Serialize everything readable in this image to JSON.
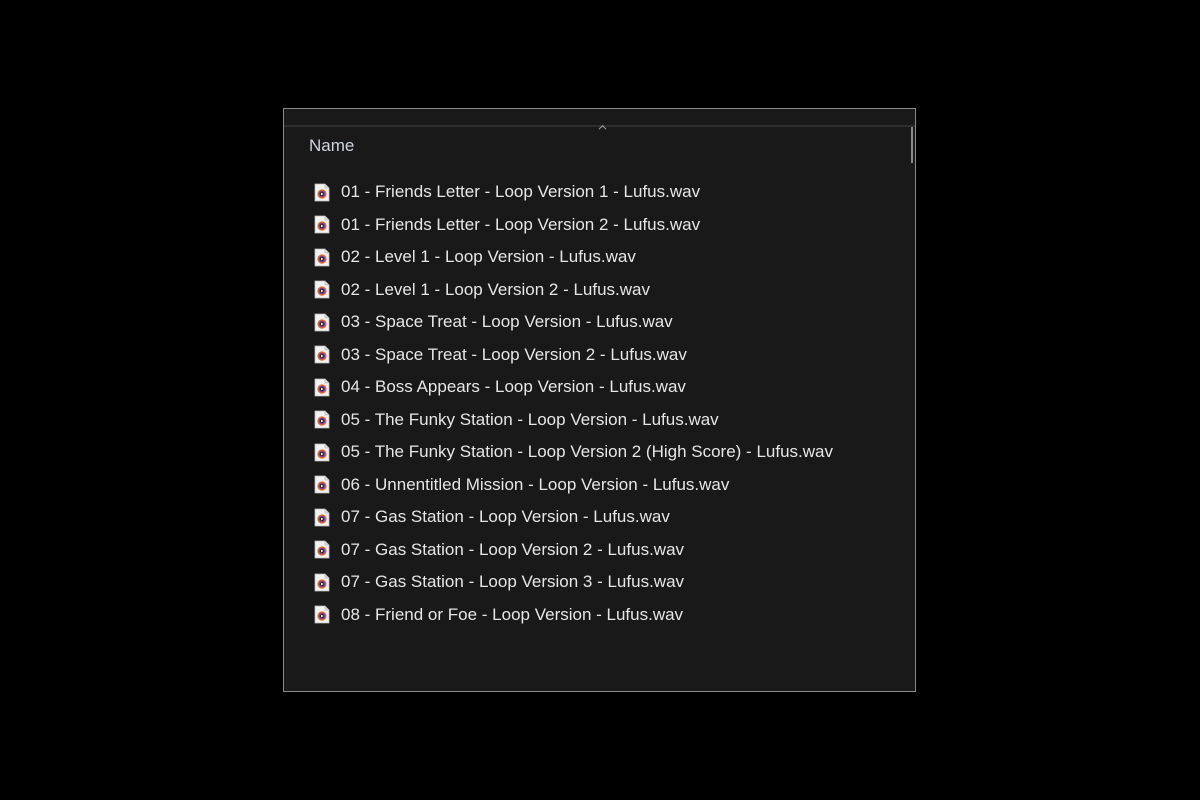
{
  "header": {
    "name_column": "Name"
  },
  "files": [
    "01 - Friends Letter - Loop Version 1 - Lufus.wav",
    "01 - Friends Letter - Loop Version 2 - Lufus.wav",
    "02 - Level 1 - Loop Version - Lufus.wav",
    "02 - Level 1 - Loop Version 2 - Lufus.wav",
    "03 - Space Treat - Loop Version - Lufus.wav",
    "03 - Space Treat - Loop Version 2 - Lufus.wav",
    "04 - Boss Appears - Loop Version - Lufus.wav",
    "05 - The Funky Station - Loop Version - Lufus.wav",
    "05 - The Funky Station - Loop Version 2 (High Score) - Lufus.wav",
    "06 - Unnentitled Mission - Loop Version - Lufus.wav",
    "07 - Gas Station - Loop Version - Lufus.wav",
    "07 - Gas Station - Loop Version 2 - Lufus.wav",
    "07 - Gas Station - Loop Version 3 - Lufus.wav",
    "08 - Friend or Foe - Loop Version - Lufus.wav"
  ],
  "file_icon": "audio-file-icon"
}
